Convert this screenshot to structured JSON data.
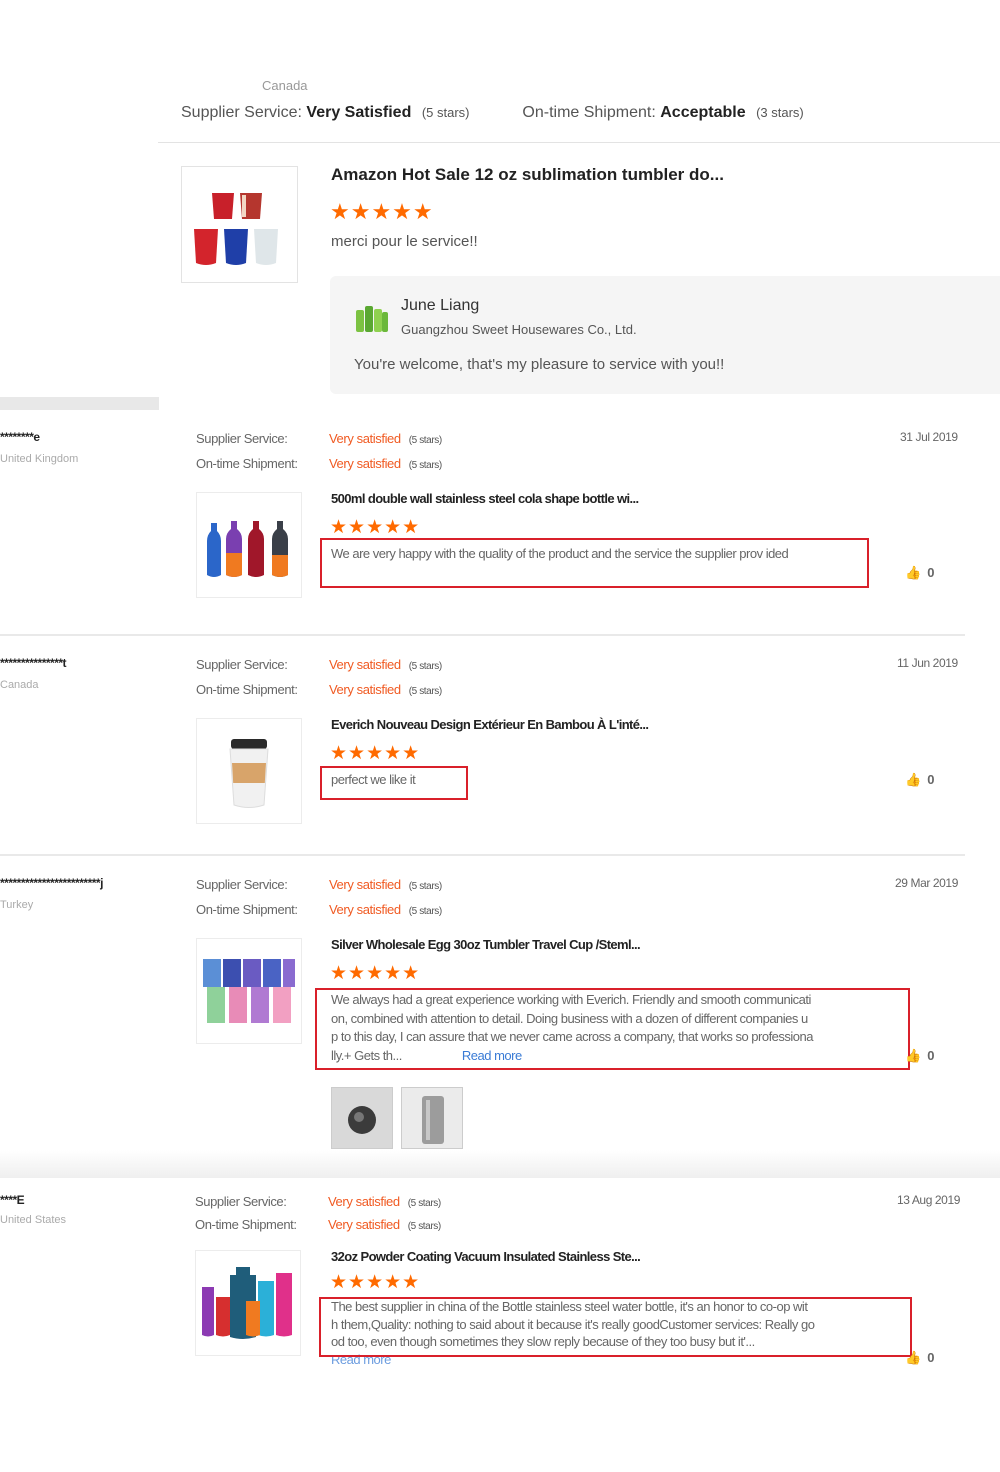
{
  "top_review": {
    "country": "Canada",
    "supplier_service_label": "Supplier Service:",
    "supplier_service_value": "Very Satisfied",
    "supplier_service_stars": "(5 stars)",
    "shipment_label": "On-time Shipment:",
    "shipment_value": "Acceptable",
    "shipment_stars": "(3 stars)",
    "product_title": "Amazon Hot Sale 12 oz sublimation tumbler do...",
    "rating": 5,
    "stars": "★★★★★",
    "comment": "merci pour le service!!",
    "reply": {
      "name": "June Liang",
      "company": "Guangzhou Sweet Housewares Co., Ltd.",
      "text": "You're welcome, that's my pleasure to service with you!!"
    }
  },
  "reviews": [
    {
      "buyer": "********e",
      "country": "United Kingdom",
      "supplier_label": "Supplier Service:",
      "supplier_value": "Very satisfied",
      "supplier_stars": "(5 stars)",
      "shipment_label": "On-time Shipment:",
      "shipment_value": "Very satisfied",
      "shipment_stars": "(5 stars)",
      "date": "31 Jul 2019",
      "product_title": "500ml double wall stainless steel cola shape bottle wi...",
      "rating": 5,
      "stars": "★★★★★",
      "comment": "We are very happy with the quality of the product and the service the supplier prov ided",
      "likes": "0"
    },
    {
      "buyer": "***************t",
      "country": "Canada",
      "supplier_label": "Supplier Service:",
      "supplier_value": "Very satisfied",
      "supplier_stars": "(5 stars)",
      "shipment_label": "On-time Shipment:",
      "shipment_value": "Very satisfied",
      "shipment_stars": "(5 stars)",
      "date": "11 Jun 2019",
      "product_title": "Everich Nouveau Design Extérieur En Bambou À L'inté...",
      "rating": 5,
      "stars": "★★★★★",
      "comment": "perfect we like it",
      "likes": "0"
    },
    {
      "buyer": "************************j",
      "country": "Turkey",
      "supplier_label": "Supplier Service:",
      "supplier_value": "Very satisfied",
      "supplier_stars": "(5 stars)",
      "shipment_label": "On-time Shipment:",
      "shipment_value": "Very satisfied",
      "shipment_stars": "(5 stars)",
      "date": "29 Mar 2019",
      "product_title": "Silver Wholesale Egg 30oz Tumbler Travel Cup /Steml...",
      "rating": 5,
      "stars": "★★★★★",
      "comment_lines": [
        "We always had a great experience working with Everich. Friendly and smooth communicati",
        "on, combined with attention to detail. Doing business with a dozen of different companies u",
        "p to this day, I can assure that we never came across a company, that works so professiona",
        "lly.+ Gets th..."
      ],
      "read_more": "Read more",
      "likes": "0"
    },
    {
      "buyer": "****E",
      "country": "United States",
      "supplier_label": "Supplier Service:",
      "supplier_value": "Very satisfied",
      "supplier_stars": "(5 stars)",
      "shipment_label": "On-time Shipment:",
      "shipment_value": "Very satisfied",
      "shipment_stars": "(5 stars)",
      "date": "13 Aug 2019",
      "product_title": "32oz Powder Coating Vacuum Insulated Stainless Ste...",
      "rating": 5,
      "stars": "★★★★★",
      "comment_lines": [
        "The best supplier in china of the Bottle stainless steel water bottle, it's an honor to co-op wit",
        "h them,Quality: nothing to said about it because it's really goodCustomer services: Really go",
        "od too, even though sometimes they slow reply because of they too busy but it'..."
      ],
      "read_more": "Read more",
      "likes": "0"
    }
  ],
  "colors": {
    "accent_orange": "#ff6a00",
    "satisfied_text": "#f05a22",
    "highlight_red": "#d9202a",
    "link_blue": "#3a7bd5"
  }
}
